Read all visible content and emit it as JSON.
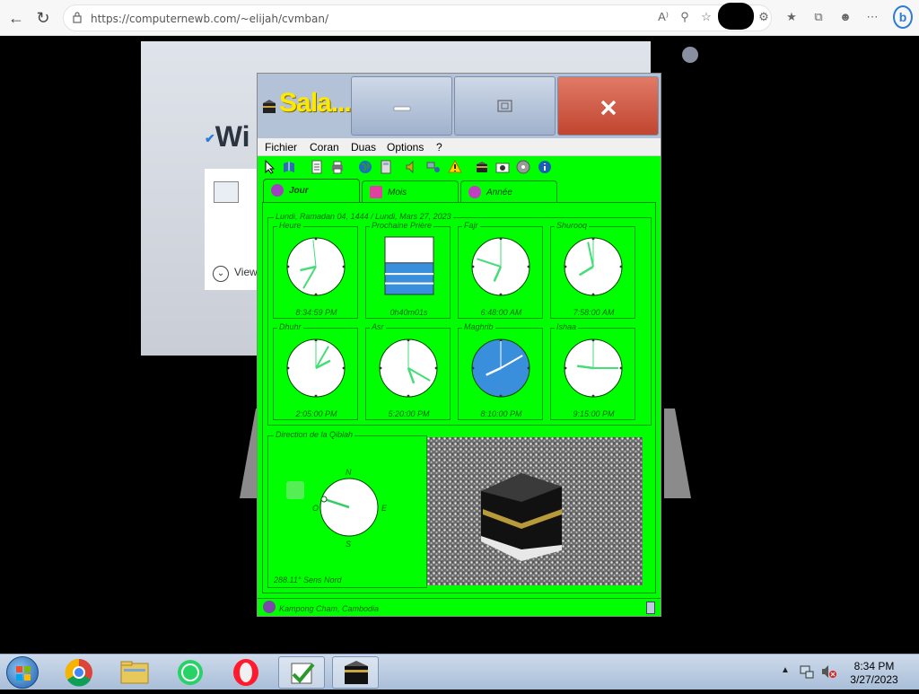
{
  "browser": {
    "url": "https://computernewb.com/~elijah/cvmban/",
    "back_icon": "back-arrow-icon",
    "refresh_icon": "refresh-icon"
  },
  "background_page": {
    "title_fragment": "Wi",
    "view_text": "View"
  },
  "app": {
    "title": "Sala...",
    "menu": [
      "Fichier",
      "Coran",
      "Duas",
      "Options",
      "?"
    ],
    "tabs": [
      {
        "label": "Jour",
        "active": true
      },
      {
        "label": "Mois",
        "active": false
      },
      {
        "label": "Année",
        "active": false
      }
    ],
    "date_line": "Lundi, Ramadan 04, 1444 / Lundi, Mars 27, 2023",
    "clocks": [
      {
        "label": "Heure",
        "time": "8:34:59 PM",
        "hour": 8,
        "minute": 34,
        "second": 59,
        "type": "clock"
      },
      {
        "label": "Prochaine Prière",
        "time": "0h40m01s",
        "type": "progress",
        "fill": 0.55
      },
      {
        "label": "Fajr",
        "time": "6:48:00 AM",
        "hour": 6,
        "minute": 48,
        "second": 0,
        "type": "clock"
      },
      {
        "label": "Shurooq",
        "time": "7:58:00 AM",
        "hour": 7,
        "minute": 58,
        "second": 0,
        "type": "clock"
      },
      {
        "label": "Dhuhr",
        "time": "2:05:00 PM",
        "hour": 2,
        "minute": 5,
        "second": 0,
        "type": "clock"
      },
      {
        "label": "Asr",
        "time": "5:20:00 PM",
        "hour": 5,
        "minute": 20,
        "second": 0,
        "type": "clock"
      },
      {
        "label": "Maghrib",
        "time": "8:10:00 PM",
        "hour": 8,
        "minute": 10,
        "second": 0,
        "type": "clock",
        "highlight": true
      },
      {
        "label": "Ishaa",
        "time": "9:15:00 PM",
        "hour": 9,
        "minute": 15,
        "second": 0,
        "type": "clock"
      }
    ],
    "qibla": {
      "legend": "Direction de la Qiblah",
      "north": "N",
      "south": "S",
      "east": "E",
      "west": "O",
      "bearing_text": "288.11° Sens Nord",
      "bearing": 288.11
    },
    "status": "Kampong Cham, Cambodia"
  },
  "taskbar": {
    "time": "8:34 PM",
    "date": "3/27/2023"
  }
}
